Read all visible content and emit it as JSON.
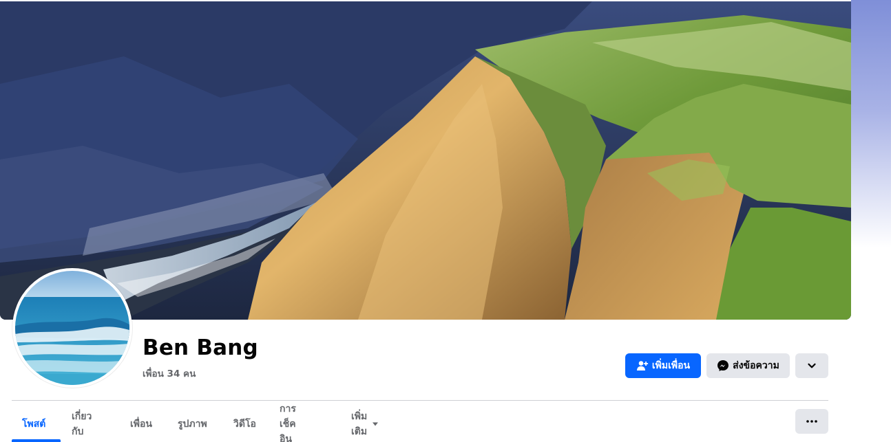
{
  "profile": {
    "name": "Ben Bang",
    "friends_text": "เพื่อน 34 คน"
  },
  "actions": {
    "add_friend_label": "เพิ่มเพื่อน",
    "message_label": "ส่งข้อความ",
    "dropdown_icon": "chevron-down-icon"
  },
  "tabs": [
    {
      "label": "โพสต์",
      "active": true
    },
    {
      "label": "เกี่ยวกับ",
      "active": false
    },
    {
      "label": "เพื่อน",
      "active": false
    },
    {
      "label": "รูปภาพ",
      "active": false
    },
    {
      "label": "วิดีโอ",
      "active": false
    },
    {
      "label": "การเช็คอิน",
      "active": false
    },
    {
      "label": "เพิ่มเติม",
      "active": false
    }
  ],
  "colors": {
    "accent": "#0866ff",
    "button_secondary": "#e4e6eb",
    "muted_text": "#65676b"
  }
}
